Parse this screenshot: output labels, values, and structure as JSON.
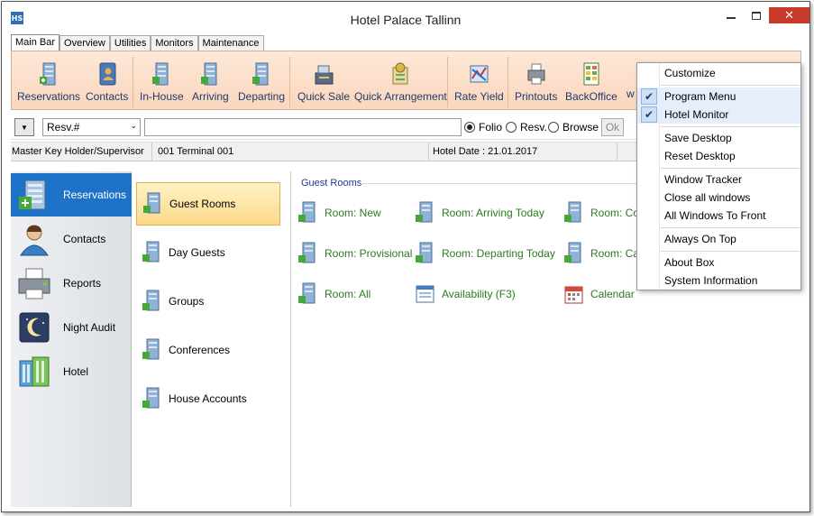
{
  "window": {
    "title": "Hotel Palace Tallinn",
    "app_icon": "HS",
    "close": "✕"
  },
  "tabs": [
    "Main Bar",
    "Overview",
    "Utilities",
    "Monitors",
    "Maintenance"
  ],
  "ribbon": {
    "buttons": [
      "Reservations",
      "Contacts",
      "In-House",
      "Arriving",
      "Departing",
      "Quick Sale",
      "Quick Arrangement",
      "Rate Yield",
      "Printouts",
      "BackOffice",
      "w"
    ]
  },
  "toolbar": {
    "dropdown_arrow": "▼",
    "select_value": "Resv.#",
    "select_arrow": "⌄",
    "search_value": "",
    "radios": [
      {
        "label": "Folio",
        "checked": true
      },
      {
        "label": "Resv.",
        "checked": false
      },
      {
        "label": "Browse",
        "checked": false
      }
    ],
    "ok_label": "Ok"
  },
  "status": {
    "user": "Master Key Holder/Supervisor",
    "terminal": "001 Terminal 001",
    "hotel_date": "Hotel Date : 21.01.2017"
  },
  "nav": {
    "items": [
      {
        "label": "Reservations",
        "icon": "hotel-building-icon"
      },
      {
        "label": "Contacts",
        "icon": "person-icon"
      },
      {
        "label": "Reports",
        "icon": "printer-icon"
      },
      {
        "label": "Night Audit",
        "icon": "moon-icon"
      },
      {
        "label": "Hotel",
        "icon": "hotel-icon"
      }
    ]
  },
  "subnav": {
    "items": [
      "Guest Rooms",
      "Day Guests",
      "Groups",
      "Conferences",
      "House Accounts"
    ]
  },
  "content": {
    "group_title": "Guest Rooms",
    "links": [
      "Room: New",
      "Room: Arriving Today",
      "Room: Cor",
      "Room: Provisional",
      "Room: Departing Today",
      "Room: Can",
      "Room: All",
      "Availability (F3)",
      "Calendar"
    ]
  },
  "menu": {
    "check": "✔",
    "items": [
      {
        "label": "Customize"
      },
      {
        "label": "Program Menu",
        "checked": true
      },
      {
        "label": "Hotel Monitor",
        "checked": true
      },
      {
        "label": "Save Desktop"
      },
      {
        "label": "Reset Desktop"
      },
      {
        "label": "Window Tracker"
      },
      {
        "label": "Close all windows"
      },
      {
        "label": "All Windows To Front"
      },
      {
        "label": "Always On Top"
      },
      {
        "label": "About Box"
      },
      {
        "label": "System Information"
      }
    ]
  },
  "colors": {
    "accent": "#1e73c9",
    "link": "#2a7a1f",
    "ribbon": "#fbd6bc",
    "close": "#c9392c"
  }
}
